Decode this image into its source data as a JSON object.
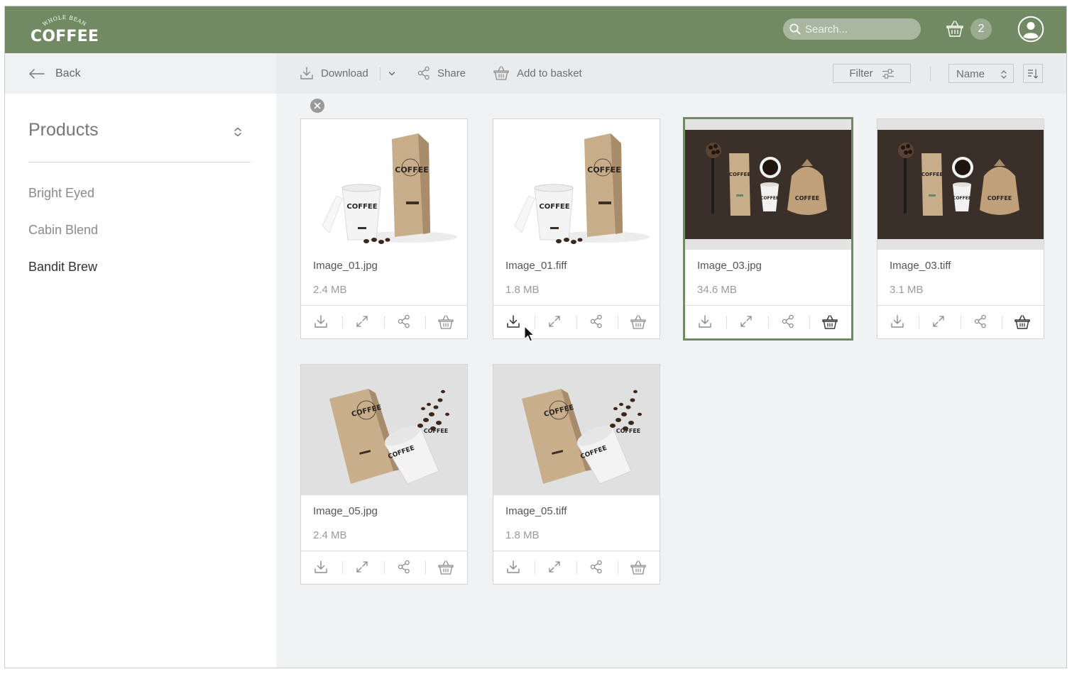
{
  "brand": {
    "top_text": "WHOLE BEAN",
    "name": "COFFEE"
  },
  "header": {
    "search_placeholder": "Search...",
    "basket_count": "2"
  },
  "sidebar": {
    "back_label": "Back",
    "section_title": "Products",
    "items": [
      {
        "label": "Bright Eyed"
      },
      {
        "label": "Cabin Blend"
      },
      {
        "label": "Bandit Brew",
        "active": true
      }
    ]
  },
  "toolbar": {
    "download_label": "Download",
    "share_label": "Share",
    "basket_label": "Add to basket",
    "filter_label": "Filter",
    "sort_value": "Name"
  },
  "files": [
    {
      "name": "Image_01.jpg",
      "size": "2.4 MB",
      "image": "bag-and-cup-white"
    },
    {
      "name": "Image_01.fiff",
      "size": "1.8 MB",
      "image": "bag-and-cup-white"
    },
    {
      "name": "Image_03.jpg",
      "size": "34.6 MB",
      "image": "flatlay-dark",
      "selected": true
    },
    {
      "name": "Image_03.tiff",
      "size": "3.1 MB",
      "image": "flatlay-dark"
    },
    {
      "name": "Image_05.jpg",
      "size": "2.4 MB",
      "image": "bag-and-spilled-cup"
    },
    {
      "name": "Image_05.tiff",
      "size": "1.8 MB",
      "image": "bag-and-spilled-cup"
    }
  ],
  "product_text": {
    "bag": "COFFEE",
    "cup": "COFFEE"
  },
  "colors": {
    "brand": "#728a63",
    "selected_border": "#728a63",
    "toolbar_bg": "#e9ebed",
    "content_bg": "#f1f2f4"
  }
}
